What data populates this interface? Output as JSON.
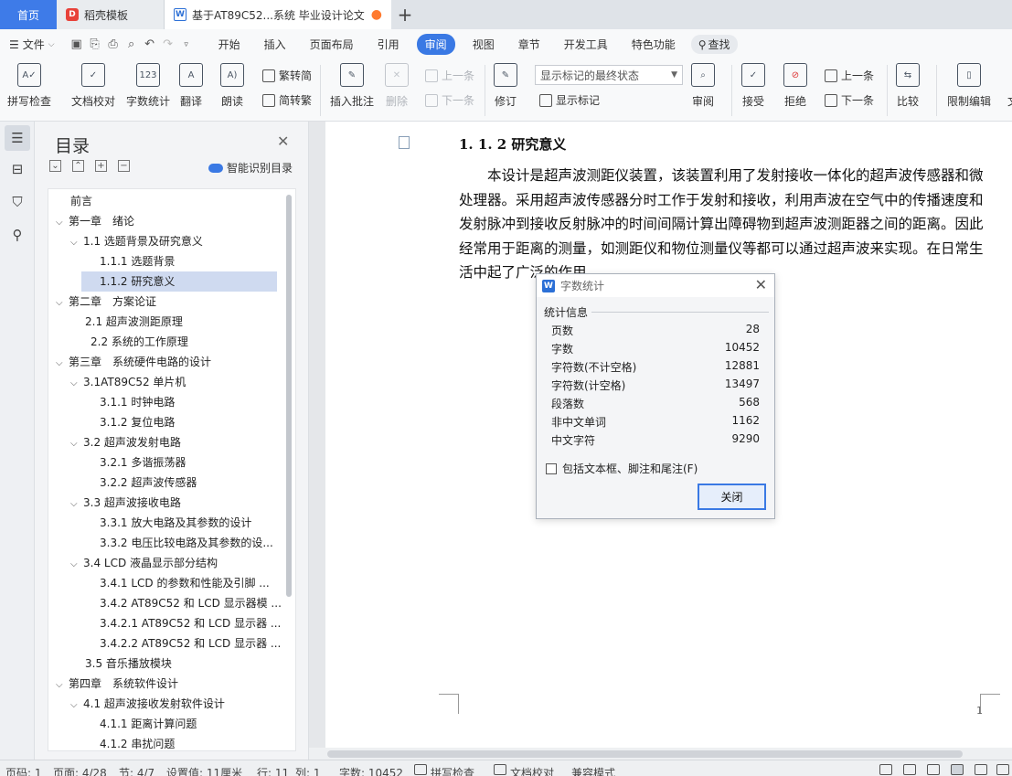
{
  "tabs": {
    "home": "首页",
    "daoke": "稻壳模板",
    "doc": "基于AT89C52...系统 毕业设计论文"
  },
  "menu": {
    "file": "文件",
    "tabs": [
      "开始",
      "插入",
      "页面布局",
      "引用",
      "审阅",
      "视图",
      "章节",
      "开发工具",
      "特色功能"
    ],
    "active_tab": "审阅",
    "search": "查找"
  },
  "ribbon": {
    "spellcheck": "拼写检查",
    "proofread": "文档校对",
    "wordcount": "字数统计",
    "translate": "翻译",
    "read_aloud": "朗读",
    "trad_to_simp": "繁转简",
    "simp_to_trad": "简转繁",
    "insert_comment": "插入批注",
    "delete": "删除",
    "prev_item": "上一条",
    "next_item": "下一条",
    "revise": "修订",
    "mark_state": "显示标记的最终状态",
    "show_marks": "显示标记",
    "review": "审阅",
    "accept": "接受",
    "reject": "拒绝",
    "prev": "上一条",
    "next": "下一条",
    "compare": "比较",
    "restrict": "限制编辑",
    "doc_cut": "文"
  },
  "toc": {
    "title": "目录",
    "smart": "智能识别目录",
    "items": [
      {
        "label": "前言"
      },
      {
        "label": "第一章　绪论"
      },
      {
        "label": "1.1 选题背景及研究意义"
      },
      {
        "label": "1.1.1  选题背景"
      },
      {
        "label": "1.1.2 研究意义"
      },
      {
        "label": "第二章　方案论证"
      },
      {
        "label": "2.1 超声波测距原理"
      },
      {
        "label": "2.2 系统的工作原理"
      },
      {
        "label": "第三章　系统硬件电路的设计"
      },
      {
        "label": "3.1AT89C52 单片机"
      },
      {
        "label": "3.1.1 时钟电路"
      },
      {
        "label": "3.1.2 复位电路"
      },
      {
        "label": "3.2 超声波发射电路"
      },
      {
        "label": "3.2.1 多谐振荡器"
      },
      {
        "label": "3.2.2 超声波传感器"
      },
      {
        "label": "3.3 超声波接收电路"
      },
      {
        "label": "3.3.1 放大电路及其参数的设计"
      },
      {
        "label": "3.3.2 电压比较电路及其参数的设..."
      },
      {
        "label": "3.4 LCD 液晶显示部分结构"
      },
      {
        "label": "3.4.1 LCD 的参数和性能及引脚 ..."
      },
      {
        "label": "3.4.2 AT89C52 和 LCD 显示器模 ..."
      },
      {
        "label": "3.4.2.1 AT89C52 和 LCD 显示器 ..."
      },
      {
        "label": "3.4.2.2 AT89C52 和 LCD 显示器 ..."
      },
      {
        "label": "3.5 音乐播放模块"
      },
      {
        "label": "第四章　系统软件设计"
      },
      {
        "label": "4.1 超声波接收发射软件设计"
      },
      {
        "label": "4.1.1 距离计算问题"
      },
      {
        "label": "4.1.2 串扰问题"
      }
    ]
  },
  "document": {
    "heading": "1. 1. 2 研究意义",
    "paragraph": "本设计是超声波测距仪装置，该装置利用了发射接收一体化的超声波传感器和微处理器。采用超声波传感器分时工作于发射和接收，利用声波在空气中的传播速度和发射脉冲到接收反射脉冲的时间间隔计算出障碍物到超声波测距器之间的距离。因此经常用于距离的测量，如测距仪和物位测量仪等都可以通过超声波来实现。在日常生活中起了广泛的作用。",
    "page_number": "1"
  },
  "dialog": {
    "title": "字数统计",
    "section": "统计信息",
    "stats": [
      {
        "label": "页数",
        "value": "28"
      },
      {
        "label": "字数",
        "value": "10452"
      },
      {
        "label": "字符数(不计空格)",
        "value": "12881"
      },
      {
        "label": "字符数(计空格)",
        "value": "13497"
      },
      {
        "label": "段落数",
        "value": "568"
      },
      {
        "label": "非中文单词",
        "value": "1162"
      },
      {
        "label": "中文字符",
        "value": "9290"
      }
    ],
    "checkbox": "包括文本框、脚注和尾注(F)",
    "close_button": "关闭"
  },
  "status": {
    "page_code": "页码: 1",
    "pages": "页面: 4/28",
    "section": "节: 4/7",
    "setting": "设置值: 11厘米",
    "row": "行: 11",
    "col": "列: 1",
    "wordcount": "字数: 10452",
    "spell": "拼写检查",
    "proof": "文档校对",
    "compat": "兼容模式"
  },
  "colors": {
    "accent": "#3a79e4",
    "home_tab": "#3e7be8",
    "unsaved_dot": "#ff7a2f"
  }
}
